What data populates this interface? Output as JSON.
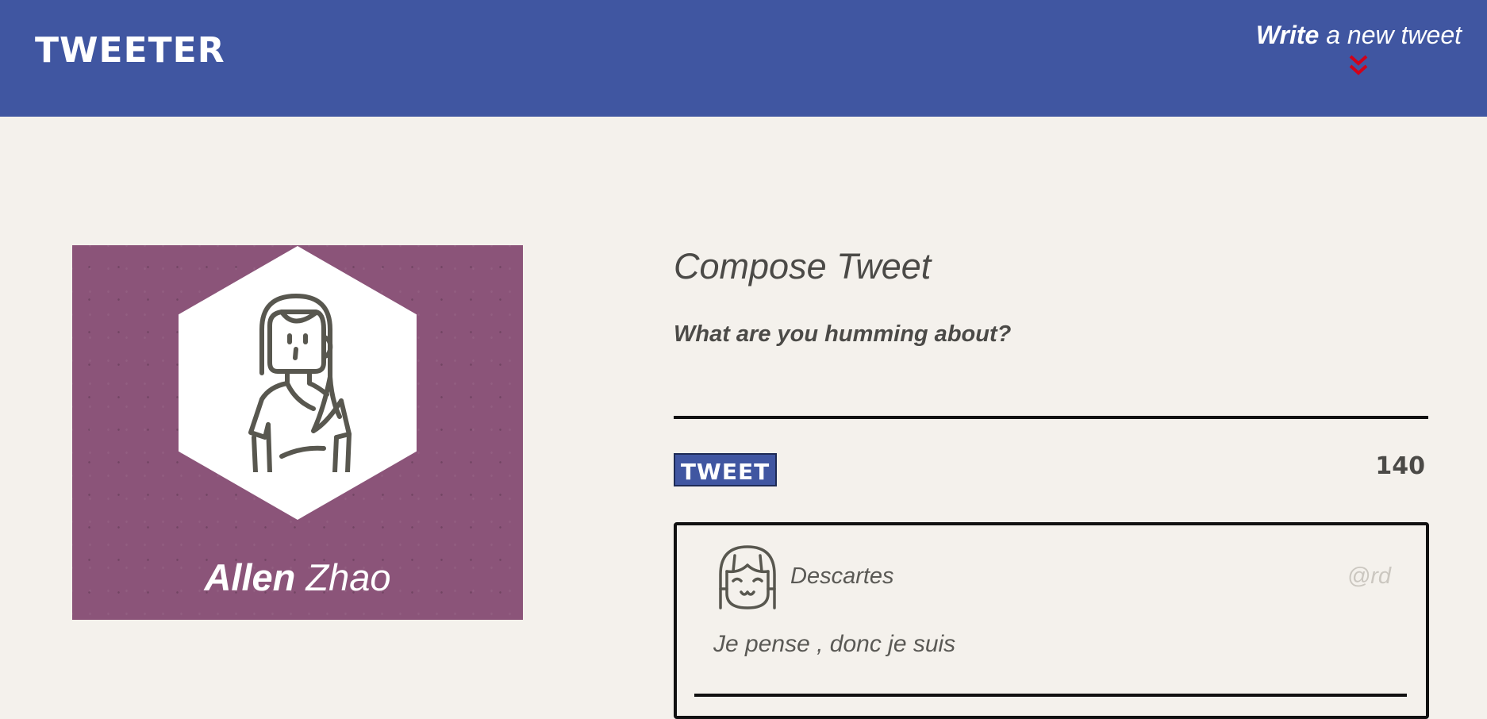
{
  "header": {
    "logo": "TWEETER",
    "write_bold": "Write",
    "write_rest": "a new tweet",
    "chevron_icon": "double-chevron-down-icon",
    "chevron_color": "#d0021b",
    "background": "#4056a1"
  },
  "profile": {
    "first_name": "Allen",
    "last_name": "Zhao",
    "avatar_icon": "girl-avatar-icon",
    "card_color": "#8b5479"
  },
  "compose": {
    "title": "Compose Tweet",
    "prompt": "What are you humming about?",
    "input_value": "",
    "button_label": "TWEET",
    "counter": "140"
  },
  "tweets": [
    {
      "name": "Descartes",
      "handle": "@rd",
      "text": "Je pense , donc je suis",
      "avatar_icon": "smiling-girl-avatar-icon"
    }
  ]
}
